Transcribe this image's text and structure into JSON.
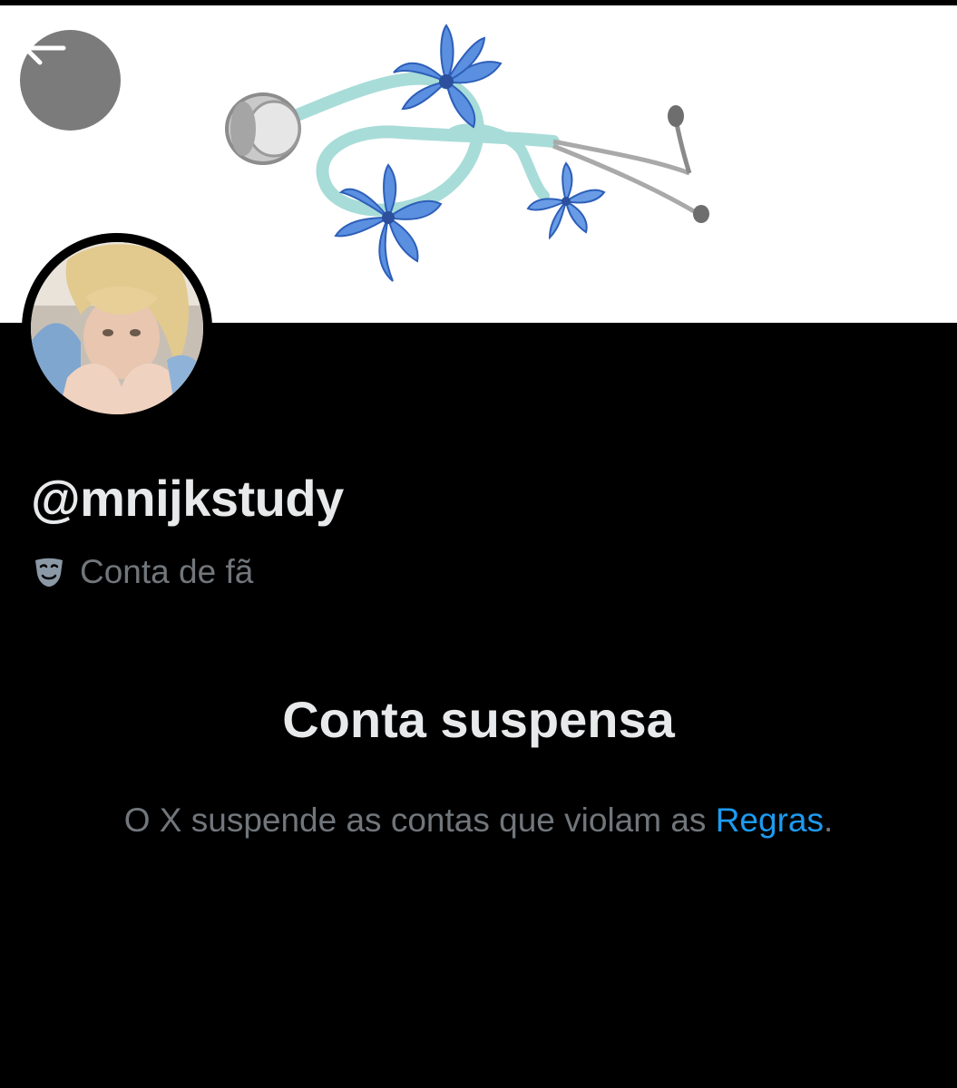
{
  "header": {
    "back_icon": "arrow-left-icon",
    "banner_image": "stethoscope with blue lily flowers"
  },
  "profile": {
    "avatar_image": "blonde person resting chin on knees",
    "handle": "@mnijkstudy",
    "account_type_icon": "theater-masks-icon",
    "account_type_label": "Conta de fã"
  },
  "suspension": {
    "title": "Conta suspensa",
    "message_prefix": "O X suspende as contas que violam as ",
    "rules_link": "Regras",
    "message_suffix": "."
  },
  "colors": {
    "background": "#000000",
    "primary_text": "#e7e9ea",
    "secondary_text": "#71767b",
    "link": "#1d9bf0",
    "back_button_bg": "#7b7b7b"
  }
}
